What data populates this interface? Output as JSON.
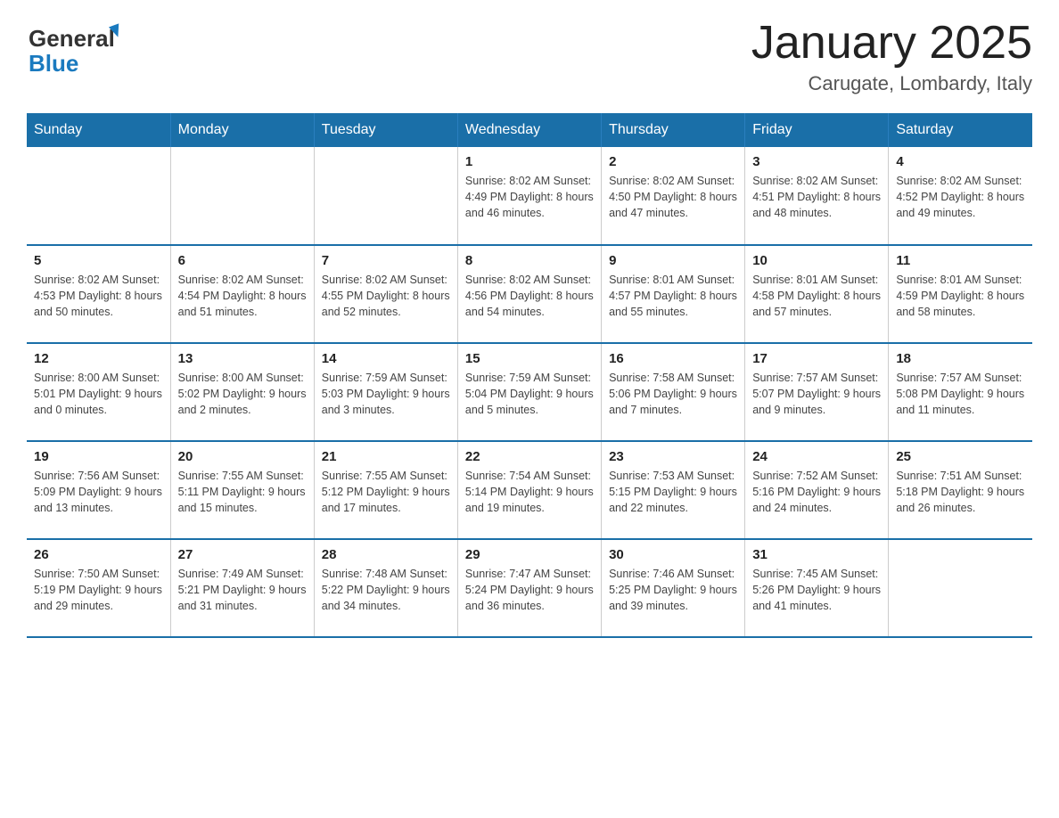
{
  "logo": {
    "general": "General",
    "blue": "Blue"
  },
  "title": "January 2025",
  "location": "Carugate, Lombardy, Italy",
  "header": {
    "colors": {
      "primary": "#1a6fa8"
    }
  },
  "weekdays": [
    "Sunday",
    "Monday",
    "Tuesday",
    "Wednesday",
    "Thursday",
    "Friday",
    "Saturday"
  ],
  "weeks": [
    {
      "days": [
        {
          "num": "",
          "info": ""
        },
        {
          "num": "",
          "info": ""
        },
        {
          "num": "",
          "info": ""
        },
        {
          "num": "1",
          "info": "Sunrise: 8:02 AM\nSunset: 4:49 PM\nDaylight: 8 hours\nand 46 minutes."
        },
        {
          "num": "2",
          "info": "Sunrise: 8:02 AM\nSunset: 4:50 PM\nDaylight: 8 hours\nand 47 minutes."
        },
        {
          "num": "3",
          "info": "Sunrise: 8:02 AM\nSunset: 4:51 PM\nDaylight: 8 hours\nand 48 minutes."
        },
        {
          "num": "4",
          "info": "Sunrise: 8:02 AM\nSunset: 4:52 PM\nDaylight: 8 hours\nand 49 minutes."
        }
      ]
    },
    {
      "days": [
        {
          "num": "5",
          "info": "Sunrise: 8:02 AM\nSunset: 4:53 PM\nDaylight: 8 hours\nand 50 minutes."
        },
        {
          "num": "6",
          "info": "Sunrise: 8:02 AM\nSunset: 4:54 PM\nDaylight: 8 hours\nand 51 minutes."
        },
        {
          "num": "7",
          "info": "Sunrise: 8:02 AM\nSunset: 4:55 PM\nDaylight: 8 hours\nand 52 minutes."
        },
        {
          "num": "8",
          "info": "Sunrise: 8:02 AM\nSunset: 4:56 PM\nDaylight: 8 hours\nand 54 minutes."
        },
        {
          "num": "9",
          "info": "Sunrise: 8:01 AM\nSunset: 4:57 PM\nDaylight: 8 hours\nand 55 minutes."
        },
        {
          "num": "10",
          "info": "Sunrise: 8:01 AM\nSunset: 4:58 PM\nDaylight: 8 hours\nand 57 minutes."
        },
        {
          "num": "11",
          "info": "Sunrise: 8:01 AM\nSunset: 4:59 PM\nDaylight: 8 hours\nand 58 minutes."
        }
      ]
    },
    {
      "days": [
        {
          "num": "12",
          "info": "Sunrise: 8:00 AM\nSunset: 5:01 PM\nDaylight: 9 hours\nand 0 minutes."
        },
        {
          "num": "13",
          "info": "Sunrise: 8:00 AM\nSunset: 5:02 PM\nDaylight: 9 hours\nand 2 minutes."
        },
        {
          "num": "14",
          "info": "Sunrise: 7:59 AM\nSunset: 5:03 PM\nDaylight: 9 hours\nand 3 minutes."
        },
        {
          "num": "15",
          "info": "Sunrise: 7:59 AM\nSunset: 5:04 PM\nDaylight: 9 hours\nand 5 minutes."
        },
        {
          "num": "16",
          "info": "Sunrise: 7:58 AM\nSunset: 5:06 PM\nDaylight: 9 hours\nand 7 minutes."
        },
        {
          "num": "17",
          "info": "Sunrise: 7:57 AM\nSunset: 5:07 PM\nDaylight: 9 hours\nand 9 minutes."
        },
        {
          "num": "18",
          "info": "Sunrise: 7:57 AM\nSunset: 5:08 PM\nDaylight: 9 hours\nand 11 minutes."
        }
      ]
    },
    {
      "days": [
        {
          "num": "19",
          "info": "Sunrise: 7:56 AM\nSunset: 5:09 PM\nDaylight: 9 hours\nand 13 minutes."
        },
        {
          "num": "20",
          "info": "Sunrise: 7:55 AM\nSunset: 5:11 PM\nDaylight: 9 hours\nand 15 minutes."
        },
        {
          "num": "21",
          "info": "Sunrise: 7:55 AM\nSunset: 5:12 PM\nDaylight: 9 hours\nand 17 minutes."
        },
        {
          "num": "22",
          "info": "Sunrise: 7:54 AM\nSunset: 5:14 PM\nDaylight: 9 hours\nand 19 minutes."
        },
        {
          "num": "23",
          "info": "Sunrise: 7:53 AM\nSunset: 5:15 PM\nDaylight: 9 hours\nand 22 minutes."
        },
        {
          "num": "24",
          "info": "Sunrise: 7:52 AM\nSunset: 5:16 PM\nDaylight: 9 hours\nand 24 minutes."
        },
        {
          "num": "25",
          "info": "Sunrise: 7:51 AM\nSunset: 5:18 PM\nDaylight: 9 hours\nand 26 minutes."
        }
      ]
    },
    {
      "days": [
        {
          "num": "26",
          "info": "Sunrise: 7:50 AM\nSunset: 5:19 PM\nDaylight: 9 hours\nand 29 minutes."
        },
        {
          "num": "27",
          "info": "Sunrise: 7:49 AM\nSunset: 5:21 PM\nDaylight: 9 hours\nand 31 minutes."
        },
        {
          "num": "28",
          "info": "Sunrise: 7:48 AM\nSunset: 5:22 PM\nDaylight: 9 hours\nand 34 minutes."
        },
        {
          "num": "29",
          "info": "Sunrise: 7:47 AM\nSunset: 5:24 PM\nDaylight: 9 hours\nand 36 minutes."
        },
        {
          "num": "30",
          "info": "Sunrise: 7:46 AM\nSunset: 5:25 PM\nDaylight: 9 hours\nand 39 minutes."
        },
        {
          "num": "31",
          "info": "Sunrise: 7:45 AM\nSunset: 5:26 PM\nDaylight: 9 hours\nand 41 minutes."
        },
        {
          "num": "",
          "info": ""
        }
      ]
    }
  ]
}
